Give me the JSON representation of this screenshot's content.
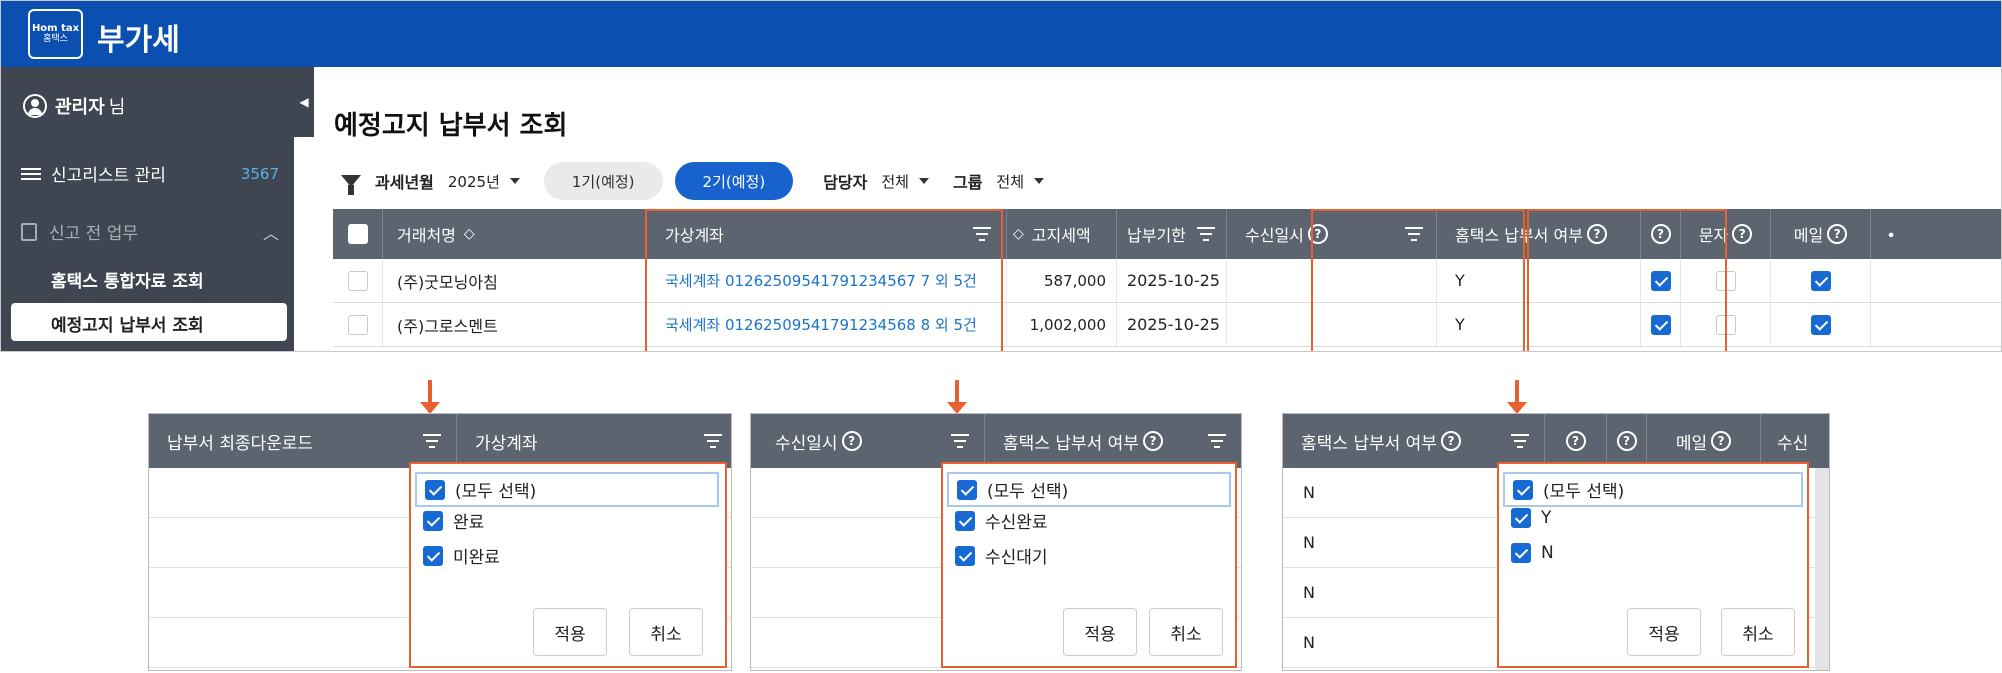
{
  "header": {
    "logo_line1": "Hom tax",
    "logo_line2": "홈택스",
    "title": "부가세"
  },
  "sidebar": {
    "user_name": "관리자",
    "user_suffix": "님",
    "menu_list_label": "신고리스트 관리",
    "menu_list_count": "3567",
    "menu_prework": "신고 전 업무",
    "sub_items": [
      "홈택스 통합자료 조회",
      "예정고지 납부서 조회"
    ]
  },
  "page": {
    "title": "예정고지 납부서 조회"
  },
  "filters": {
    "tax_period_label": "과세년월",
    "tax_period_value": "2025년",
    "pill_1": "1기(예정)",
    "pill_2": "2기(예정)",
    "manager_label": "담당자",
    "manager_value": "전체",
    "group_label": "그룹",
    "group_value": "전체"
  },
  "grid": {
    "columns": {
      "company": "거래처명",
      "vaccount": "가상계좌",
      "amount": "고지세액",
      "due": "납부기한",
      "received": "수신일시",
      "hometax": "홈택스 납부서 여부",
      "q": "",
      "sms": "문자",
      "mail": "메일"
    },
    "rows": [
      {
        "company": "(주)굿모닝아침",
        "vaccount": "국세계좌 01262509541791234567 7 외 5건",
        "amount": "587,000",
        "due": "2025-10-25",
        "received": "",
        "hometax": "Y"
      },
      {
        "company": "(주)그로스멘트",
        "vaccount": "국세계좌 01262509541791234568 8 외 5건",
        "amount": "1,002,000",
        "due": "2025-10-25",
        "received": "",
        "hometax": "Y"
      }
    ]
  },
  "panel1": {
    "col_a": "납부서 최종다운로드",
    "col_b": "가상계좌",
    "options": [
      "(모두 선택)",
      "완료",
      "미완료"
    ],
    "apply": "적용",
    "cancel": "취소"
  },
  "panel2": {
    "col_a": "수신일시",
    "col_b": "홈택스 납부서 여부",
    "options": [
      "(모두 선택)",
      "수신완료",
      "수신대기"
    ],
    "apply": "적용",
    "cancel": "취소"
  },
  "panel3": {
    "col_a": "홈택스 납부서 여부",
    "col_mail": "메일",
    "col_cut": "수신",
    "rows": [
      "N",
      "N",
      "N",
      "N"
    ],
    "options": [
      "(모두 선택)",
      "Y",
      "N"
    ],
    "apply": "적용",
    "cancel": "취소"
  }
}
